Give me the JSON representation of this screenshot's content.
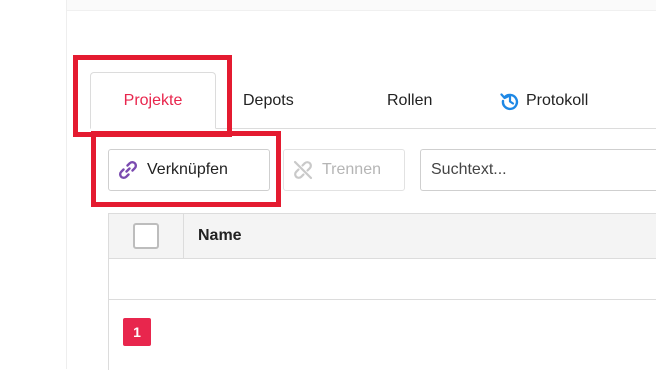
{
  "tabs": [
    {
      "label": "Projekte",
      "active": true
    },
    {
      "label": "Depots",
      "active": false
    },
    {
      "label": "Rollen",
      "active": false
    },
    {
      "label": "Protokoll",
      "active": false,
      "icon": "history-icon"
    }
  ],
  "toolbar": {
    "link_label": "Verknüpfen",
    "link_icon": "link-icon",
    "unlink_label": "Trennen",
    "unlink_icon": "unlink-icon",
    "unlink_disabled": true,
    "search_placeholder": "Suchtext..."
  },
  "table": {
    "columns": [
      "Name"
    ],
    "rows": []
  },
  "pagination": {
    "current_page": "1"
  },
  "colors": {
    "accent": "#e8264d",
    "highlight_box": "#e41b30",
    "protokoll_icon": "#1e88e5",
    "link_icon": "#7b4bb0"
  }
}
